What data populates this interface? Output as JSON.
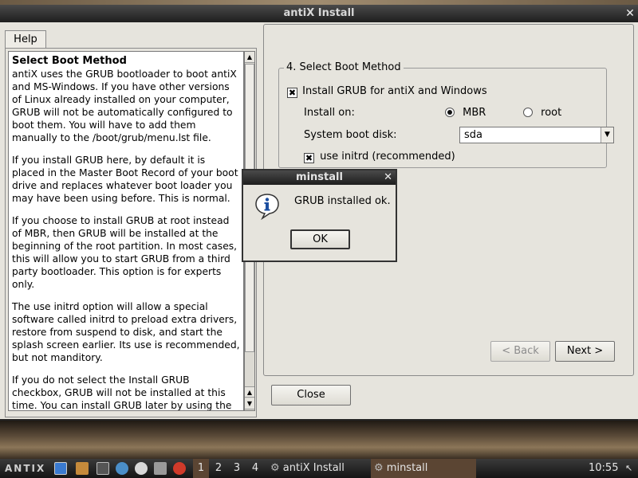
{
  "window": {
    "title": "antiX Install",
    "close_glyph": "✕"
  },
  "help": {
    "tab_label": "Help",
    "title": "Select Boot Method",
    "paragraphs": [
      "antiX uses the GRUB bootloader to boot antiX and MS-Windows. If you have other versions of Linux already installed on your computer, GRUB will not be automatically configured to boot them. You will have to add them manually to the /boot/grub/menu.lst file.",
      "If you install GRUB here, by default it is placed in the Master Boot Record of your boot drive and replaces whatever boot loader you may have been using before. This is normal.",
      "If you choose to install GRUB at root instead of MBR, then GRUB will be installed at the beginning of the root partition. In most cases, this will allow you to start GRUB from a third party bootloader. This option is for experts only.",
      "The use initrd option will allow a special software called initrd to preload extra drivers, restore from suspend to disk, and start the splash screen earlier. Its use is recommended, but not manditory.",
      "If you do not select the Install GRUB checkbox, GRUB will not be installed at this time. You can install GRUB later by using the"
    ],
    "scroll_up": "▲",
    "scroll_down": "▼"
  },
  "boot": {
    "group_title": "4. Select Boot Method",
    "install_grub_label": "Install GRUB for antiX and Windows",
    "install_grub_checked": "✖",
    "install_on_label": "Install on:",
    "mbr_label": "MBR",
    "root_label": "root",
    "selected_location": "MBR",
    "boot_disk_label": "System boot disk:",
    "boot_disk_value": "sda",
    "combo_arrow": "▼",
    "initrd_label": "use initrd (recommended)",
    "initrd_checked": "✖"
  },
  "nav": {
    "back_label": "< Back",
    "next_label": "Next >",
    "close_label": "Close"
  },
  "dialog": {
    "title": "minstall",
    "close_glyph": "✕",
    "message": "GRUB installed ok.",
    "ok_label": "OK"
  },
  "taskbar": {
    "logo": "ANTIX",
    "desktops": [
      "1",
      "2",
      "3",
      "4"
    ],
    "active_desktop": "1",
    "tasks": [
      "antiX Install",
      "minstall"
    ],
    "clock": "10:55",
    "colors": {
      "active_task": "#5b4533",
      "panel": "#1e1e1e"
    }
  }
}
